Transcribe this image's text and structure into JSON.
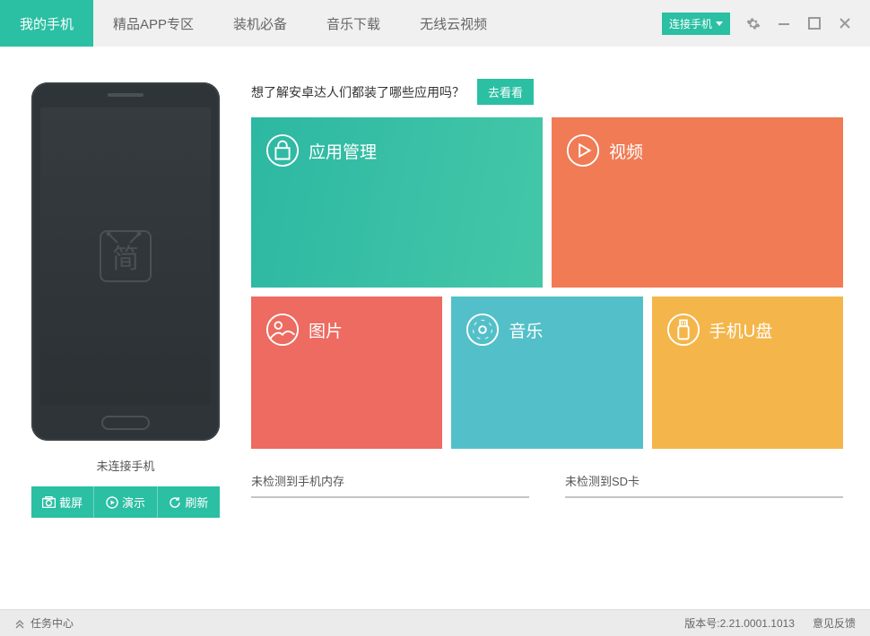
{
  "nav": {
    "tabs": [
      {
        "label": "我的手机",
        "active": true
      },
      {
        "label": "精品APP专区",
        "active": false
      },
      {
        "label": "装机必备",
        "active": false
      },
      {
        "label": "音乐下载",
        "active": false
      },
      {
        "label": "无线云视频",
        "active": false
      }
    ],
    "connect_label": "连接手机"
  },
  "phone": {
    "status": "未连接手机",
    "logo_char": "简",
    "actions": {
      "screenshot": "截屏",
      "demo": "演示",
      "refresh": "刷新"
    }
  },
  "promo": {
    "text": "想了解安卓达人们都装了哪些应用吗？",
    "button": "去看看"
  },
  "tiles": {
    "apps": "应用管理",
    "video": "视频",
    "photo": "图片",
    "music": "音乐",
    "udisk": "手机U盘"
  },
  "storage": {
    "memory": "未检测到手机内存",
    "sdcard": "未检测到SD卡"
  },
  "footer": {
    "task_center": "任务中心",
    "version_label": "版本号:",
    "version": "2.21.0001.1013",
    "feedback": "意见反馈"
  }
}
